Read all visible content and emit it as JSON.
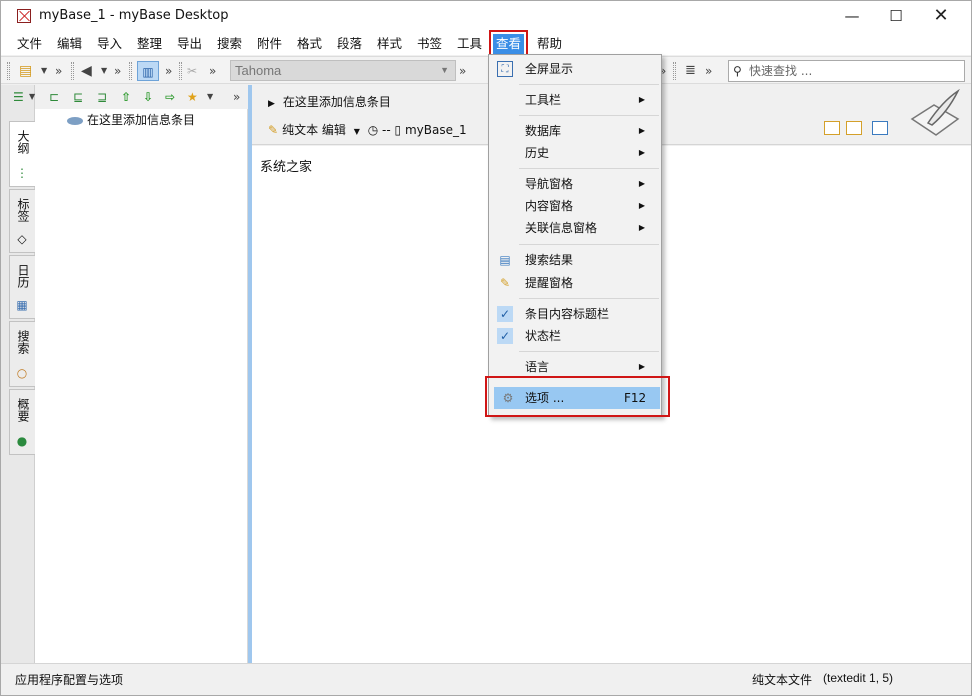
{
  "window": {
    "title": "myBase_1 - myBase Desktop",
    "controls": {
      "minimize": "—",
      "maximize": "☐",
      "close": "✕"
    }
  },
  "menubar": {
    "items": [
      "文件",
      "编辑",
      "导入",
      "整理",
      "导出",
      "搜索",
      "附件",
      "格式",
      "段落",
      "样式",
      "书签",
      "工具",
      "查看",
      "帮助"
    ],
    "active": "查看"
  },
  "toolbar": {
    "font_name": "Tahoma",
    "search_placeholder": "快速查找 ...",
    "chevron": "»"
  },
  "side_tabs": [
    {
      "label": "大纲",
      "icon": "outline-icon",
      "active": true
    },
    {
      "label": "标签",
      "icon": "tag-icon",
      "active": false
    },
    {
      "label": "日历",
      "icon": "calendar-icon",
      "active": false
    },
    {
      "label": "搜索",
      "icon": "search-icon",
      "active": false
    },
    {
      "label": "概要",
      "icon": "globe-icon",
      "active": false
    }
  ],
  "outline": {
    "root_node": "在这里添加信息条目"
  },
  "content": {
    "breadcrumb": "在这里添加信息条目",
    "editor_mode": "纯文本 编辑",
    "separator": "--",
    "db_name": "myBase_1",
    "body_text": "系统之家"
  },
  "view_menu": {
    "items": [
      {
        "label": "全屏显示",
        "icon": "fullscreen-icon",
        "submenu": false
      },
      {
        "label": "工具栏",
        "submenu": true
      },
      {
        "label": "数据库",
        "submenu": true
      },
      {
        "label": "历史",
        "submenu": true
      },
      {
        "label": "导航窗格",
        "submenu": true
      },
      {
        "label": "内容窗格",
        "submenu": true
      },
      {
        "label": "关联信息窗格",
        "submenu": true
      },
      {
        "label": "搜索结果",
        "icon": "search-results-icon",
        "submenu": false
      },
      {
        "label": "提醒窗格",
        "icon": "reminder-icon",
        "submenu": false
      },
      {
        "label": "条目内容标题栏",
        "checked": true,
        "submenu": false
      },
      {
        "label": "状态栏",
        "checked": true,
        "submenu": false
      },
      {
        "label": "语言",
        "submenu": true
      },
      {
        "label": "选项 ...",
        "shortcut": "F12",
        "icon": "gear-icon",
        "highlighted": true
      }
    ]
  },
  "statusbar": {
    "left_text": "应用程序配置与选项",
    "file_type": "纯文本文件",
    "position": "(textedit 1, 5)"
  },
  "colors": {
    "accent": "#3a8ee6",
    "highlight": "#98c8f2",
    "annotation_red": "#d01616",
    "splitter": "#9fc7ee"
  }
}
